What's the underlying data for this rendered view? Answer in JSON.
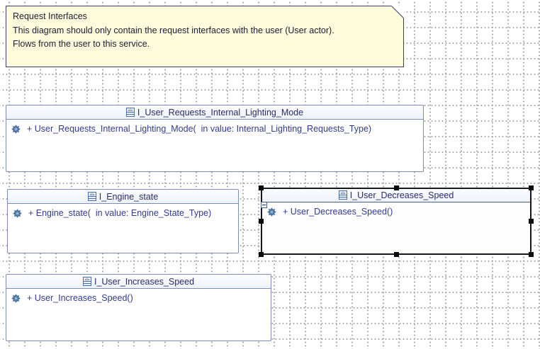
{
  "note": {
    "lines": [
      "Request Interfaces",
      "This diagram should only contain the request interfaces with the user (User actor).",
      "Flows from the user to this service."
    ]
  },
  "interfaces": [
    {
      "name": "I_User_Requests_Internal_Lighting_Mode",
      "operation": "+ User_Requests_Internal_Lighting_Mode(  in value: Internal_Lighting_Requests_Type)",
      "selected": false
    },
    {
      "name": "I_Engine_state",
      "operation": "+ Engine_state(  in value: Engine_State_Type)",
      "selected": false
    },
    {
      "name": "I_User_Decreases_Speed",
      "operation": "+ User_Decreases_Speed()",
      "selected": true
    },
    {
      "name": "I_User_Increases_Speed",
      "operation": "+ User_Increases_Speed()",
      "selected": false
    }
  ],
  "icons": {
    "interface_icon_label": "«I»",
    "header_icon": "interface-classifier-icon",
    "operation_icon": "gear-icon",
    "note_fold_icon": "folded-corner"
  },
  "colors": {
    "note_fill": "#fdfbdc",
    "note_border": "#3c3c6e",
    "box_border": "#7b8fb6",
    "selected_border": "#17171f",
    "title_text": "#2c2a68",
    "operation_text": "#313b8e",
    "grid_dot": "#a6a6a6",
    "header_fill": "#f2f5fa",
    "body_fill": "#ffffff"
  }
}
